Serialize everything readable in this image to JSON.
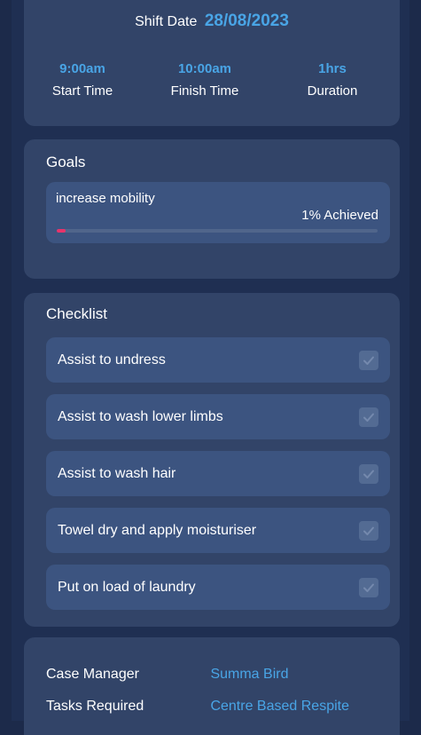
{
  "shift": {
    "date_label": "Shift Date",
    "date_value": "28/08/2023",
    "times": [
      {
        "value": "9:00am",
        "label": "Start Time"
      },
      {
        "value": "10:00am",
        "label": "Finish Time"
      },
      {
        "value": "1hrs",
        "label": "Duration"
      }
    ]
  },
  "goals": {
    "title": "Goals",
    "items": [
      {
        "name": "increase mobility",
        "achieved": "1% Achieved",
        "progress_percent": 1
      }
    ]
  },
  "checklist": {
    "title": "Checklist",
    "items": [
      {
        "label": "Assist to undress",
        "checked": true
      },
      {
        "label": "Assist to wash lower limbs",
        "checked": true
      },
      {
        "label": "Assist to wash hair",
        "checked": true
      },
      {
        "label": "Towel dry and apply moisturiser",
        "checked": true
      },
      {
        "label": "Put on load of laundry",
        "checked": true
      }
    ]
  },
  "info": {
    "rows": [
      {
        "label": "Case Manager",
        "value": "Summa Bird"
      },
      {
        "label": "Tasks Required",
        "value": "Centre Based Respite"
      }
    ]
  },
  "colors": {
    "accent": "#49a5e6",
    "progress": "#e8336a",
    "card": "#324468",
    "item": "#3c5480",
    "background": "#1c2a4a"
  }
}
